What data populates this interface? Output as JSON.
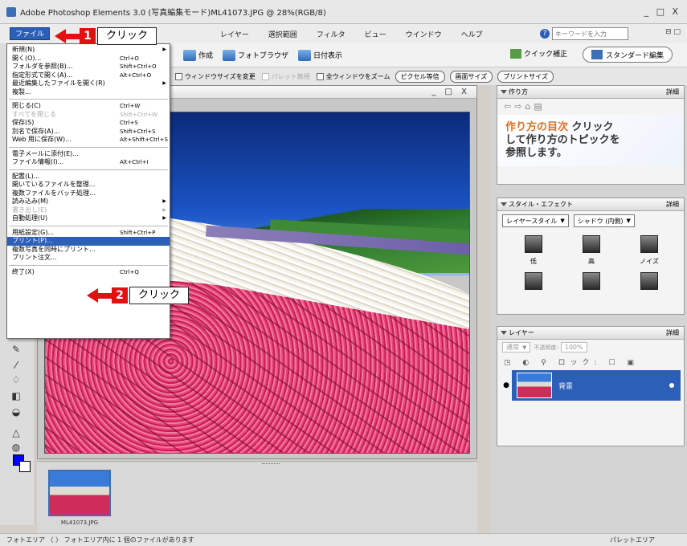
{
  "window": {
    "title": "Adobe Photoshop Elements 3.0 (写真編集モード)ML41073.JPG @ 28%(RGB/8)",
    "controls": "_ □ X"
  },
  "menubar": {
    "items": [
      "ファイル",
      "レイヤー",
      "選択範囲",
      "フィルタ",
      "ビュー",
      "ウインドウ",
      "ヘルプ"
    ],
    "help_placeholder": "キーワードを入力",
    "tail": "⊟ □"
  },
  "shortcuts": {
    "create": "作成",
    "browser": "フォトブラウザ",
    "date_view": "日付表示",
    "quick_fix": "クイック補正",
    "standard_edit": "スタンダード編集"
  },
  "options": {
    "resize_window": "ウィンドウサイズを変更",
    "ignore_palette": "パレット無視",
    "zoom_all": "全ウィンドウをズーム",
    "actual_pixels": "ピクセル等倍",
    "fit_screen": "画面サイズ",
    "print_size": "プリントサイズ"
  },
  "file_menu": {
    "items": [
      {
        "label": "新規(N)",
        "shortcut": "",
        "submenu": true
      },
      {
        "label": "開く(O)...",
        "shortcut": "Ctrl+O"
      },
      {
        "label": "フォルダを参照(B)...",
        "shortcut": "Shift+Ctrl+O"
      },
      {
        "label": "指定形式で開く(A)...",
        "shortcut": "Alt+Ctrl+O"
      },
      {
        "label": "最近編集したファイルを開く(R)",
        "shortcut": "",
        "submenu": true
      },
      {
        "label": "複製...",
        "shortcut": ""
      },
      {
        "sep": true
      },
      {
        "label": "閉じる(C)",
        "shortcut": "Ctrl+W"
      },
      {
        "label": "すべてを閉じる",
        "shortcut": "Shift+Ctrl+W",
        "disabled": true
      },
      {
        "label": "保存(S)",
        "shortcut": "Ctrl+S"
      },
      {
        "label": "別名で保存(A)...",
        "shortcut": "Shift+Ctrl+S"
      },
      {
        "label": "Web 用に保存(W)...",
        "shortcut": "Alt+Shift+Ctrl+S"
      },
      {
        "sep": true
      },
      {
        "label": "電子メールに添付(E)...",
        "shortcut": ""
      },
      {
        "label": "ファイル情報(I)...",
        "shortcut": "Alt+Ctrl+I"
      },
      {
        "sep": true
      },
      {
        "label": "配置(L)...",
        "shortcut": ""
      },
      {
        "label": "開いているファイルを整理...",
        "shortcut": ""
      },
      {
        "label": "複数ファイルをバッチ処理...",
        "shortcut": ""
      },
      {
        "label": "読み込み(M)",
        "shortcut": "",
        "submenu": true
      },
      {
        "label": "書き出し(E)",
        "shortcut": "",
        "submenu": true,
        "disabled": true
      },
      {
        "label": "自動処理(U)",
        "shortcut": "",
        "submenu": true
      },
      {
        "sep": true
      },
      {
        "label": "用紙設定(G)...",
        "shortcut": "Shift+Ctrl+P"
      },
      {
        "label": "プリント(P)...",
        "shortcut": "",
        "selected": true
      },
      {
        "label": "複数写真を同時にプリント...",
        "shortcut": ""
      },
      {
        "label": "プリント注文...",
        "shortcut": ""
      },
      {
        "sep": true
      },
      {
        "label": "終了(X)",
        "shortcut": "Ctrl+Q"
      }
    ]
  },
  "callouts": [
    {
      "number": "1",
      "label": "クリック"
    },
    {
      "number": "2",
      "label": "クリック"
    }
  ],
  "document": {
    "controls": "_ □ X"
  },
  "photo_bin": {
    "thumb_label": "ML41073.JPG"
  },
  "status": {
    "left": "フォトエリア 〈 〉 フォトエリア内に 1 個のファイルがあります",
    "right": "パレットエリア"
  },
  "panels": {
    "howto": {
      "title": "作り方",
      "more": "詳細",
      "line1": "作り方の目次",
      "line1b": "クリック",
      "line2": "して作り方のトピックを",
      "line3": "参照します。"
    },
    "styles": {
      "title": "スタイル・エフェクト",
      "more": "詳細",
      "select1": "レイヤースタイル",
      "select2": "シャドウ (内側)",
      "effects": [
        "低",
        "高",
        "ノイズ"
      ]
    },
    "layers": {
      "title": "レイヤー",
      "more": "詳細",
      "mode": "通常",
      "opacity_label": "不透明度:",
      "opacity_value": "100%",
      "lock_label": "ロック:",
      "layer_name": "背景"
    }
  },
  "colors": {
    "accent": "#2c5fb8",
    "callout_red": "#e21010",
    "foreground": "#0000ff",
    "background": "#ffffff"
  }
}
